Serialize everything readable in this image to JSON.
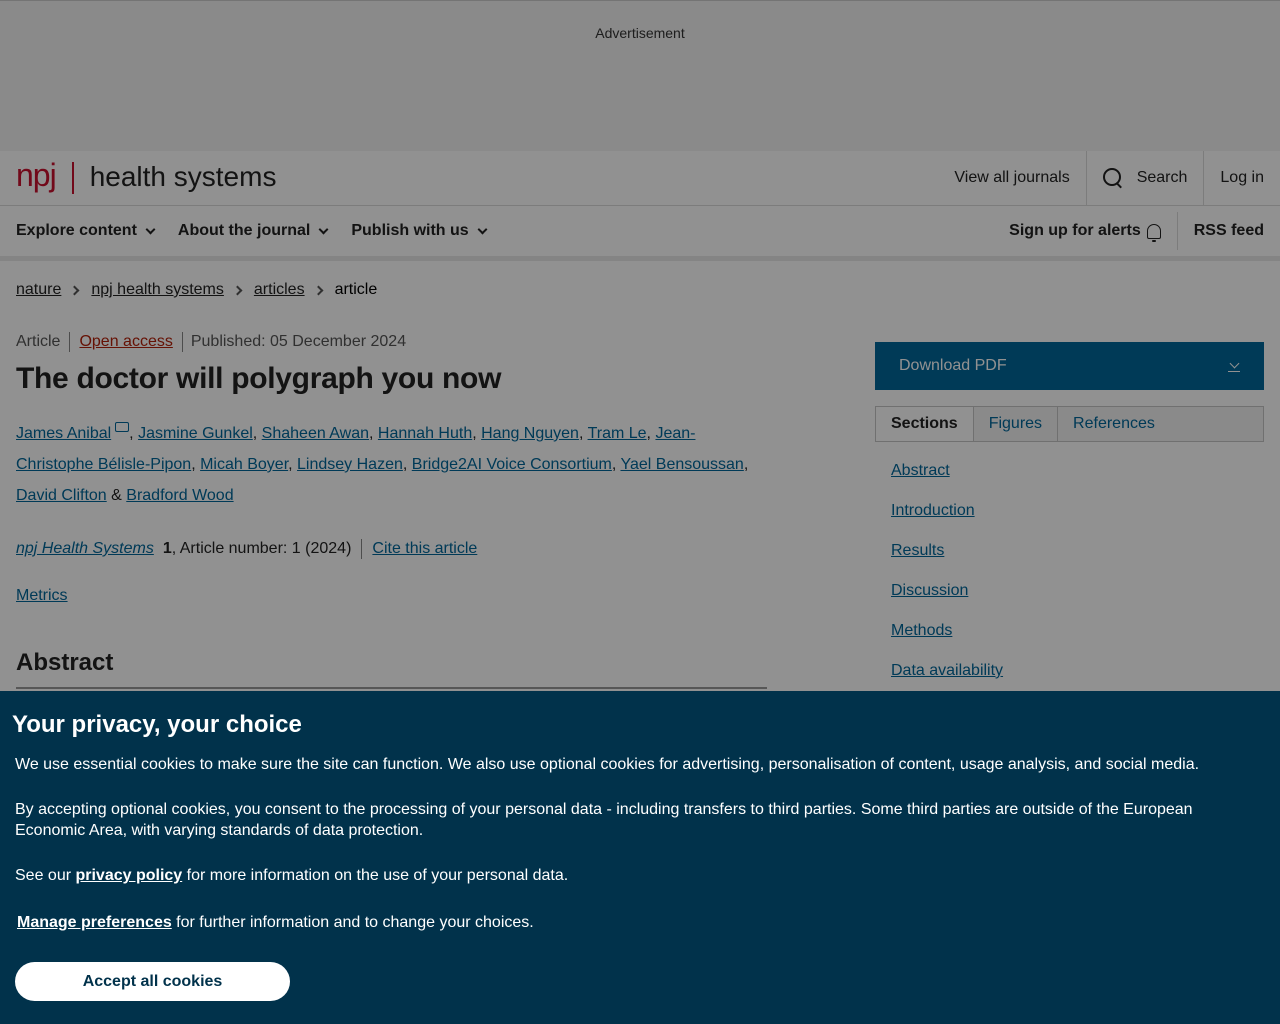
{
  "ad": {
    "label": "Advertisement"
  },
  "brand": {
    "logo_mark": "npj",
    "logo_name": "health systems"
  },
  "header": {
    "view_all": "View all journals",
    "search": "Search",
    "login": "Log in"
  },
  "nav": {
    "items": [
      "Explore content",
      "About the journal",
      "Publish with us"
    ],
    "alerts": "Sign up for alerts",
    "rss": "RSS feed"
  },
  "breadcrumb": [
    "nature",
    "npj health systems",
    "articles",
    "article"
  ],
  "article": {
    "type": "Article",
    "access": "Open access",
    "published": "Published: 05 December 2024",
    "title": "The doctor will polygraph you now",
    "authors": [
      "James Anibal",
      "Jasmine Gunkel",
      "Shaheen Awan",
      "Hannah Huth",
      "Hang Nguyen",
      "Tram Le",
      "Jean-Christophe Bélisle-Pipon",
      "Micah Boyer",
      "Lindsey Hazen",
      "Bridge2AI Voice Consortium",
      "Yael Bensoussan",
      "David Clifton",
      "Bradford Wood"
    ],
    "journal": "npj Health Systems",
    "volume": "1",
    "article_number": ", Article number: 1 (2024)",
    "cite": "Cite this article",
    "metrics": "Metrics",
    "abstract_heading": "Abstract"
  },
  "sidebar": {
    "download": "Download PDF",
    "tabs": [
      "Sections",
      "Figures",
      "References"
    ],
    "sections": [
      "Abstract",
      "Introduction",
      "Results",
      "Discussion",
      "Methods",
      "Data availability"
    ]
  },
  "cookie": {
    "title": "Your privacy, your choice",
    "p1": "We use essential cookies to make sure the site can function. We also use optional cookies for advertising, personalisation of content, usage analysis, and social media.",
    "p2": "By accepting optional cookies, you consent to the processing of your personal data - including transfers to third parties. Some third parties are outside of the European Economic Area, with varying standards of data protection.",
    "p3_pre": "See our ",
    "p3_link": "privacy policy",
    "p3_post": " for more information on the use of your personal data.",
    "manage": "Manage preferences",
    "manage_post": " for further information and to change your choices.",
    "accept": "Accept all cookies"
  }
}
